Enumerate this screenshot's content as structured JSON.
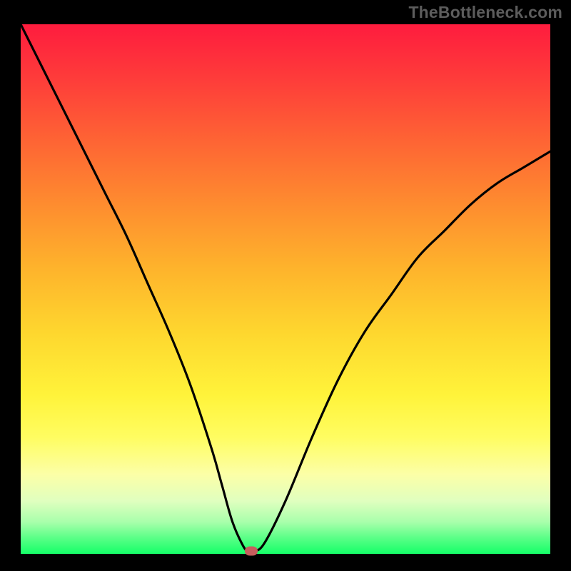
{
  "watermark": "TheBottleneck.com",
  "chart_data": {
    "type": "line",
    "title": "",
    "xlabel": "",
    "ylabel": "",
    "xlim": [
      0,
      100
    ],
    "ylim": [
      0,
      100
    ],
    "grid": false,
    "legend": false,
    "background": "rainbow-vertical-gradient",
    "series": [
      {
        "name": "bottleneck-curve",
        "color": "#000000",
        "x": [
          0,
          4,
          8,
          12,
          16,
          20,
          24,
          28,
          32,
          36,
          38,
          40,
          42,
          43,
          44,
          46,
          50,
          55,
          60,
          65,
          70,
          75,
          80,
          85,
          90,
          95,
          100
        ],
        "y": [
          100,
          92,
          84,
          76,
          68,
          60,
          51,
          42,
          32,
          20,
          13,
          6,
          1.5,
          0.5,
          0.5,
          2,
          10,
          22,
          33,
          42,
          49,
          56,
          61,
          66,
          70,
          73,
          76
        ]
      }
    ],
    "annotations": [
      {
        "type": "marker",
        "shape": "rounded-rect",
        "color": "#c75d5d",
        "x": 43.5,
        "y": 0.5
      }
    ]
  }
}
